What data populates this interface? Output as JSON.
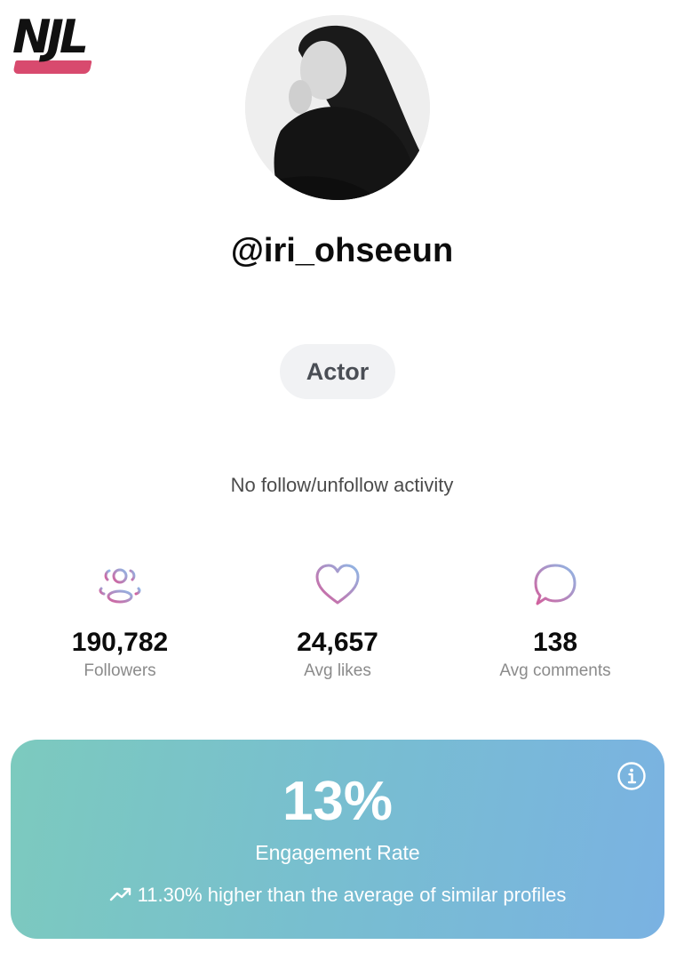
{
  "brand": {
    "logo_text": "NJL",
    "logo_accent_color": "#d84a6e"
  },
  "profile": {
    "username": "@iri_ohseeun",
    "category": "Actor",
    "activity_note": "No follow/unfollow activity"
  },
  "stats": [
    {
      "icon": "users-icon",
      "value": "190,782",
      "label": "Followers"
    },
    {
      "icon": "heart-icon",
      "value": "24,657",
      "label": "Avg likes"
    },
    {
      "icon": "comment-bubble-icon",
      "value": "138",
      "label": "Avg comments"
    }
  ],
  "engagement": {
    "value": "13%",
    "label": "Engagement Rate",
    "comparison": "11.30% higher than the average of similar profiles",
    "trend_icon": "trending-up-icon",
    "info_icon": "info-icon",
    "gradient_colors": [
      "#7ccabe",
      "#7ab2e2"
    ]
  },
  "icon_gradient_colors": [
    "#d35f9c",
    "#8fb8e6"
  ]
}
